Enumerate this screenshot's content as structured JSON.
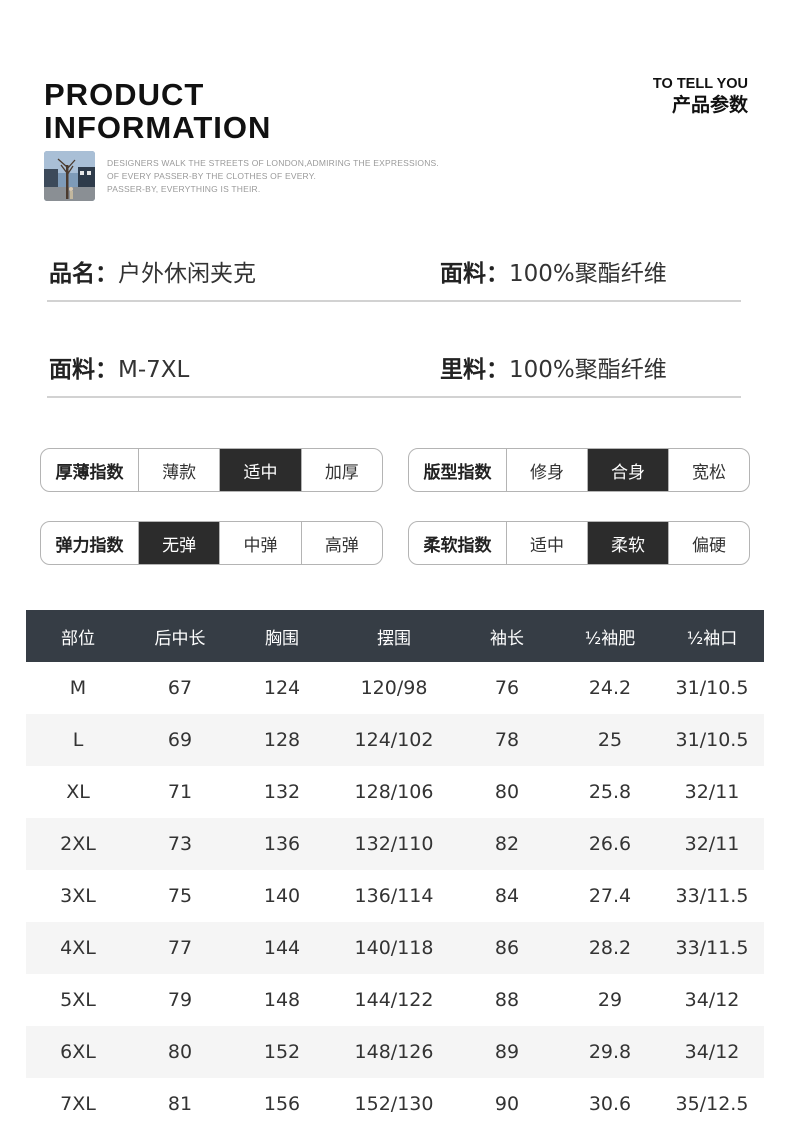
{
  "header": {
    "title_line1": "PRODUCT",
    "title_line2": "INFORMATION",
    "tell_en": "TO TELL YOU",
    "tell_cn": "产品参数",
    "slogan": [
      "DESIGNERS WALK THE STREETS OF LONDON,ADMIRING THE EXPRESSIONS.",
      "OF EVERY PASSER-BY THE CLOTHES OF EVERY.",
      "PASSER-BY, EVERYTHING IS THEIR."
    ]
  },
  "info": [
    {
      "left_label": "品名：",
      "left_value": "户外休闲夹克",
      "right_label": "面料：",
      "right_value": "100%聚酯纤维"
    },
    {
      "left_label": "面料：",
      "left_value": "M-7XL",
      "right_label": "里料：",
      "right_value": "100%聚酯纤维"
    }
  ],
  "indices": [
    {
      "label": "厚薄指数",
      "options": [
        "薄款",
        "适中",
        "加厚"
      ],
      "selected": 1
    },
    {
      "label": "版型指数",
      "options": [
        "修身",
        "合身",
        "宽松"
      ],
      "selected": 1
    },
    {
      "label": "弹力指数",
      "options": [
        "无弹",
        "中弹",
        "高弹"
      ],
      "selected": 0
    },
    {
      "label": "柔软指数",
      "options": [
        "适中",
        "柔软",
        "偏硬"
      ],
      "selected": 1
    }
  ],
  "colors": {
    "selected_bg": "#2c2c2c",
    "table_header_bg": "#363d45",
    "row_alt_bg": "#f5f5f5"
  },
  "table": {
    "headers": [
      "部位",
      "后中长",
      "胸围",
      "摆围",
      "袖长",
      "½袖肥",
      "½袖口"
    ],
    "rows": [
      [
        "M",
        "67",
        "124",
        "120/98",
        "76",
        "24.2",
        "31/10.5"
      ],
      [
        "L",
        "69",
        "128",
        "124/102",
        "78",
        "25",
        "31/10.5"
      ],
      [
        "XL",
        "71",
        "132",
        "128/106",
        "80",
        "25.8",
        "32/11"
      ],
      [
        "2XL",
        "73",
        "136",
        "132/110",
        "82",
        "26.6",
        "32/11"
      ],
      [
        "3XL",
        "75",
        "140",
        "136/114",
        "84",
        "27.4",
        "33/11.5"
      ],
      [
        "4XL",
        "77",
        "144",
        "140/118",
        "86",
        "28.2",
        "33/11.5"
      ],
      [
        "5XL",
        "79",
        "148",
        "144/122",
        "88",
        "29",
        "34/12"
      ],
      [
        "6XL",
        "80",
        "152",
        "148/126",
        "89",
        "29.8",
        "34/12"
      ],
      [
        "7XL",
        "81",
        "156",
        "152/130",
        "90",
        "30.6",
        "35/12.5"
      ]
    ]
  }
}
